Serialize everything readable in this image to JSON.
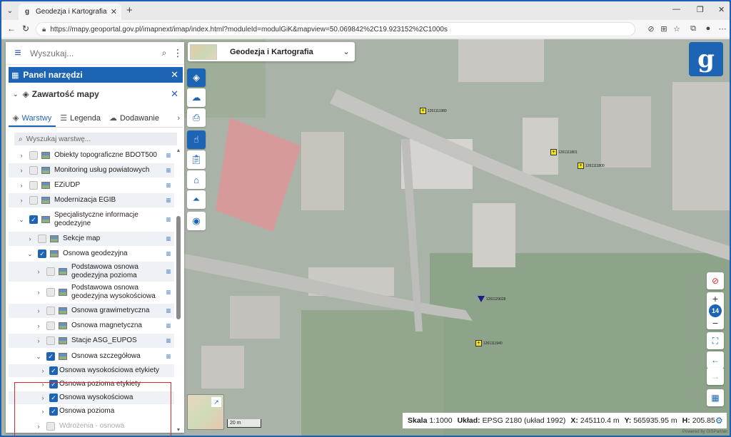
{
  "browser": {
    "tab_title": "Geodezja i Kartografia - Geoportal",
    "url": "https://mapy.geoportal.gov.pl/imapnext/imap/index.html?moduleId=modulGiK&mapview=50.069842%2C19.923152%2C1000s"
  },
  "sidebar": {
    "search_placeholder": "Wyszukaj...",
    "tool_panel_title": "Panel narzędzi",
    "map_content_title": "Zawartość mapy",
    "tabs": [
      {
        "label": "Warstwy"
      },
      {
        "label": "Legenda"
      },
      {
        "label": "Dodawanie"
      }
    ],
    "layer_search_placeholder": "Wyszukaj warstwę...",
    "layers": [
      {
        "label": "Obiekty topograficzne BDOT500",
        "checked": false
      },
      {
        "label": "Monitoring usług powiatowych",
        "checked": false
      },
      {
        "label": "EZiUDP",
        "checked": false
      },
      {
        "label": "Modernizacja EGIB",
        "checked": false
      },
      {
        "label": "Specjalistyczne informacje geodezyjne",
        "checked": true
      },
      {
        "label": "Sekcje map",
        "checked": false
      },
      {
        "label": "Osnowa geodezyjna",
        "checked": true
      },
      {
        "label": "Podstawowa osnowa geodezyjna pozioma",
        "checked": false
      },
      {
        "label": "Podstawowa osnowa geodezyjna wysokościowa",
        "checked": false
      },
      {
        "label": "Osnowa grawimetryczna",
        "checked": false
      },
      {
        "label": "Osnowa magnetyczna",
        "checked": false
      },
      {
        "label": "Stacje ASG_EUPOS",
        "checked": false
      },
      {
        "label": "Osnowa szczegółowa",
        "checked": true
      },
      {
        "label": "Osnowa wysokościowa etykiety",
        "checked": true
      },
      {
        "label": "Osnowa pozioma etykiety",
        "checked": true
      },
      {
        "label": "Osnowa wysokościowa",
        "checked": true
      },
      {
        "label": "Osnowa pozioma",
        "checked": true
      },
      {
        "label": "Wdrożenia - osnowa",
        "checked": false
      }
    ]
  },
  "module_selector": {
    "label": "Geodezja i Kartografia"
  },
  "map": {
    "zoom_level": "14",
    "scale_bar_label": "20 m",
    "markers": [
      {
        "label": "1261111980",
        "kind": "square"
      },
      {
        "label": "1261111801",
        "kind": "square"
      },
      {
        "label": "1261111800",
        "kind": "square"
      },
      {
        "label": "1261129028",
        "kind": "triangle"
      },
      {
        "label": "1261111940",
        "kind": "square"
      }
    ]
  },
  "status_bar": {
    "scale_label": "Skala",
    "scale_value": "1:1000",
    "crs_label": "Układ:",
    "crs_value": "EPSG 2180 (układ 1992)",
    "x_label": "X:",
    "x_value": "245110.4 m",
    "y_label": "Y:",
    "y_value": "565935.95 m",
    "h_label": "H:",
    "h_value": "205.85",
    "powered_by": "Powered by GISPartner"
  },
  "colors": {
    "accent": "#1e64b5",
    "highlight_border": "#e0262d",
    "marker_fill": "#f3e31f"
  }
}
